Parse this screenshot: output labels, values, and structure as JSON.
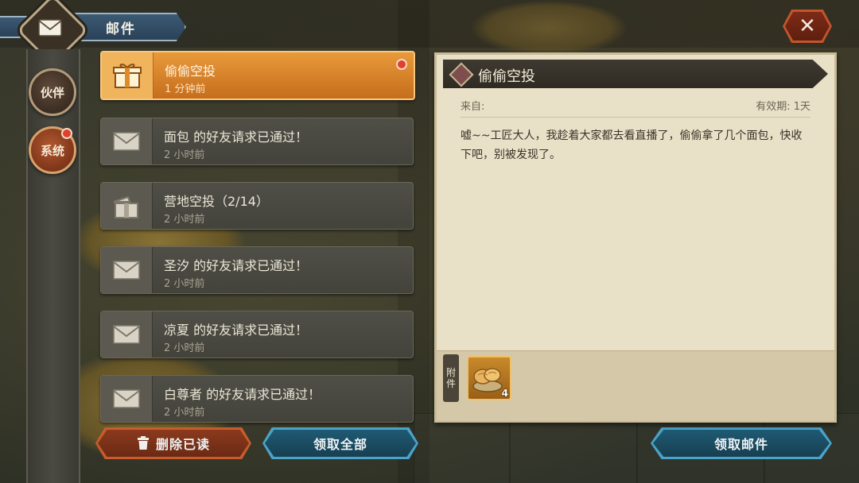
{
  "header": {
    "title": "邮件",
    "icon": "envelope-icon"
  },
  "tabs": [
    {
      "label": "伙伴",
      "icon": "partner-tab",
      "has_notification": false,
      "selected": false
    },
    {
      "label": "系统",
      "icon": "system-tab",
      "has_notification": true,
      "selected": true
    }
  ],
  "mails": [
    {
      "title": "偷偷空投",
      "time": "1 分钟前",
      "icon": "gift-icon",
      "active": true,
      "unread": true
    },
    {
      "title": "面包 的好友请求已通过！",
      "time": "2 小时前",
      "icon": "envelope-icon",
      "active": false,
      "unread": false
    },
    {
      "title": "营地空投（2/14）",
      "time": "2 小时前",
      "icon": "opened-gift-icon",
      "active": false,
      "unread": false
    },
    {
      "title": "圣汐 的好友请求已通过！",
      "time": "2 小时前",
      "icon": "envelope-icon",
      "active": false,
      "unread": false
    },
    {
      "title": "凉夏 的好友请求已通过！",
      "time": "2 小时前",
      "icon": "envelope-icon",
      "active": false,
      "unread": false
    },
    {
      "title": "白尊者 的好友请求已通过！",
      "time": "2 小时前",
      "icon": "envelope-icon",
      "active": false,
      "unread": false
    }
  ],
  "detail": {
    "title": "偷偷空投",
    "from_label": "来自:",
    "expiry_label": "有效期: 1天",
    "body": "嘘~~工匠大人，我趁着大家都去看直播了，偷偷拿了几个面包，快收下吧，别被发现了。",
    "attachment_label_1": "附",
    "attachment_label_2": "件",
    "attachments": [
      {
        "item": "bread-basket-icon",
        "count": "4"
      }
    ]
  },
  "buttons": {
    "delete_read": "删除已读",
    "claim_all": "领取全部",
    "claim_mail": "领取邮件"
  },
  "colors": {
    "active_mail": "#e89a3a",
    "red_button": "#c95b2c",
    "blue_button": "#4aa3c9",
    "panel": "#e9e0c8",
    "notification_dot": "#e0402d"
  }
}
